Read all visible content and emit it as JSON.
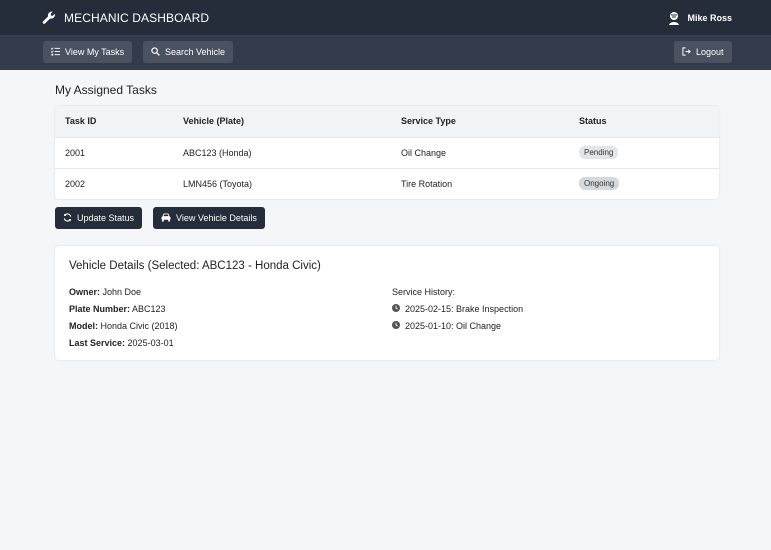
{
  "header": {
    "title": "MECHANIC DASHBOARD",
    "user_name": "Mike Ross"
  },
  "nav": {
    "view_tasks": "View My Tasks",
    "search_vehicle": "Search Vehicle",
    "logout": "Logout"
  },
  "tasks": {
    "title": "My Assigned Tasks",
    "columns": [
      "Task ID",
      "Vehicle (Plate)",
      "Service Type",
      "Status"
    ],
    "rows": [
      {
        "id": "2001",
        "vehicle": "ABC123 (Honda)",
        "service": "Oil Change",
        "status": "Pending"
      },
      {
        "id": "2002",
        "vehicle": "LMN456 (Toyota)",
        "service": "Tire Rotation",
        "status": "Ongoing"
      }
    ]
  },
  "actions": {
    "update_status": "Update Status",
    "view_details": "View Vehicle Details"
  },
  "details": {
    "title": "Vehicle Details (Selected: ABC123 - Honda Civic)",
    "owner_label": "Owner:",
    "owner": "John Doe",
    "plate_label": "Plate Number:",
    "plate": "ABC123",
    "model_label": "Model:",
    "model": "Honda Civic (2018)",
    "last_service_label": "Last Service:",
    "last_service": "2025-03-01",
    "history_label": "Service History:",
    "history": [
      "2025-02-15: Brake Inspection",
      "2025-01-10: Oil Change"
    ]
  },
  "colors": {
    "topbar": "#262d3a",
    "navbar": "#343c4b",
    "button_dark": "#262d3a",
    "badge": "#e3e5e8"
  }
}
